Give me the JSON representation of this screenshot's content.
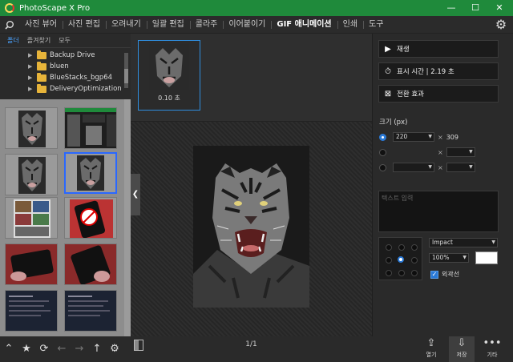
{
  "window": {
    "title": "PhotoScape X Pro",
    "minimize": "—",
    "maximize": "☐",
    "close": "✕"
  },
  "menu": {
    "tabs": [
      "사진 뷰어",
      "사진 편집",
      "오려내기",
      "일괄 편집",
      "콜라주",
      "이어붙이기",
      "GIF 애니메이션",
      "인쇄",
      "도구"
    ],
    "active_tab": "GIF 애니메이션"
  },
  "left_panel": {
    "tabs": [
      "폴더",
      "즐겨찾기",
      "모두"
    ],
    "active_tab": "폴더",
    "folders": [
      "Backup Drive",
      "bluen",
      "BlueStacks_bgp64",
      "DeliveryOptimization"
    ]
  },
  "strip": {
    "frame_delay": "0.10 초"
  },
  "canvas": {
    "page_indicator": "1/1"
  },
  "right_panel": {
    "play": "재생",
    "display_time": "표시 시간 | 2.19 초",
    "transition": "전환 효과",
    "size_title": "크기 (px)",
    "size_width": "220",
    "size_height": "309",
    "text_placeholder": "텍스트 입력",
    "font": "Impact",
    "font_size": "100%",
    "outline": "외곽선"
  },
  "bottom_right": {
    "open": "열기",
    "save": "저장",
    "more": "기타"
  },
  "colors": {
    "titlebar": "#1f8a3b",
    "accent": "#2a79d6",
    "selection": "#2a68ff"
  }
}
